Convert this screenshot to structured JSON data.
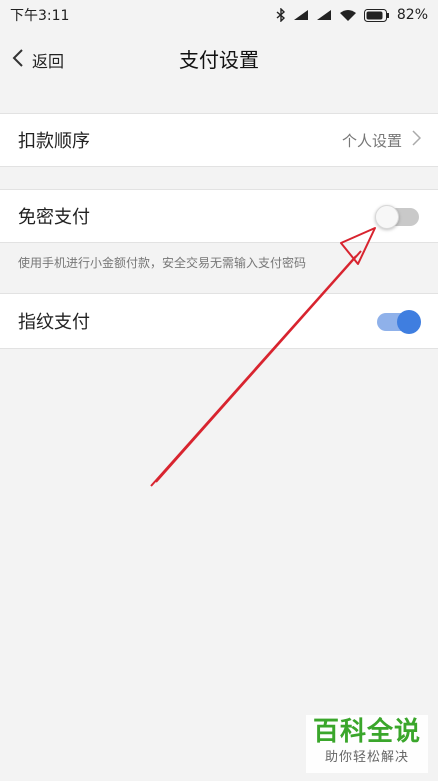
{
  "status_bar": {
    "time": "下午3:11",
    "battery": "82%",
    "icons": [
      "bluetooth-icon",
      "signal-icon",
      "signal-icon",
      "wifi-icon",
      "battery-icon"
    ]
  },
  "nav": {
    "back_label": "返回",
    "title": "支付设置"
  },
  "settings": {
    "deduction_order": {
      "label": "扣款顺序",
      "value": "个人设置"
    },
    "password_free": {
      "label": "免密支付",
      "enabled": false,
      "hint": "使用手机进行小金额付款，安全交易无需输入支付密码"
    },
    "fingerprint": {
      "label": "指纹支付",
      "enabled": true
    }
  },
  "colors": {
    "toggle_on": "#3f7ee0",
    "annotation_arrow": "#d8242f",
    "watermark_green": "#3aa62b"
  },
  "watermark": {
    "main": "百科全说",
    "sub": "助你轻松解决"
  }
}
